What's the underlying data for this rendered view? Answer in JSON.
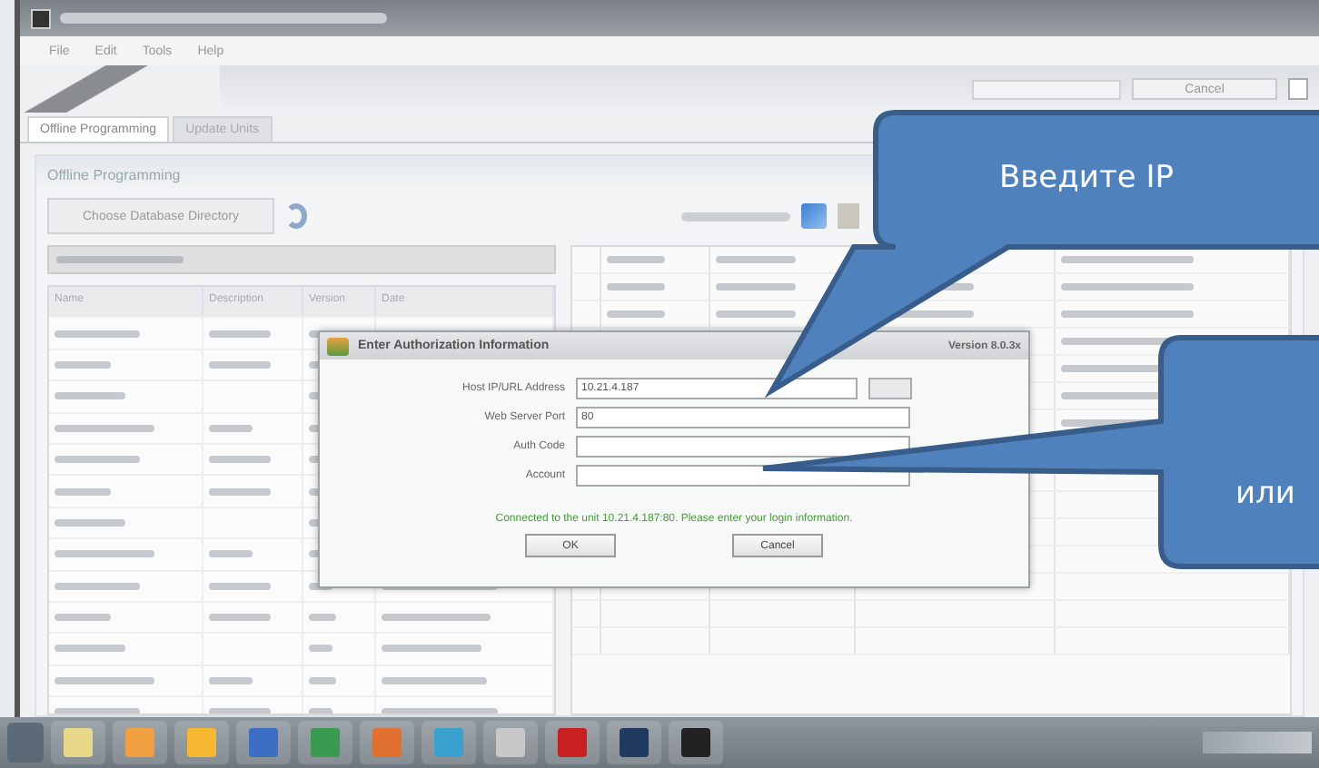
{
  "menu": [
    "File",
    "Edit",
    "Tools",
    "Help"
  ],
  "toolbar": {
    "cancel": "Cancel"
  },
  "tabs": [
    {
      "label": "Offline Programming",
      "selected": true
    },
    {
      "label": "Update Units",
      "selected": false
    }
  ],
  "panel": {
    "title": "Offline Programming",
    "button": "Choose Database Directory"
  },
  "table": {
    "columns": [
      "Name",
      "Description",
      "Version",
      "Date"
    ]
  },
  "dialog": {
    "title": "Enter Authorization Information",
    "version": "Version 8.0.3x",
    "fields": [
      {
        "label": "Host IP/URL Address",
        "value": "10.21.4.187",
        "browse": true
      },
      {
        "label": "Web Server Port",
        "value": "80",
        "browse": false
      },
      {
        "label": "Auth Code",
        "browse": false
      },
      {
        "label": "Account",
        "browse": false
      }
    ],
    "message": "Connected to the unit 10.21.4.187:80. Please enter your login information.",
    "buttons": [
      "OK",
      "Cancel"
    ]
  },
  "callouts": [
    {
      "text": "Введите IP"
    },
    {
      "text": "или"
    }
  ]
}
